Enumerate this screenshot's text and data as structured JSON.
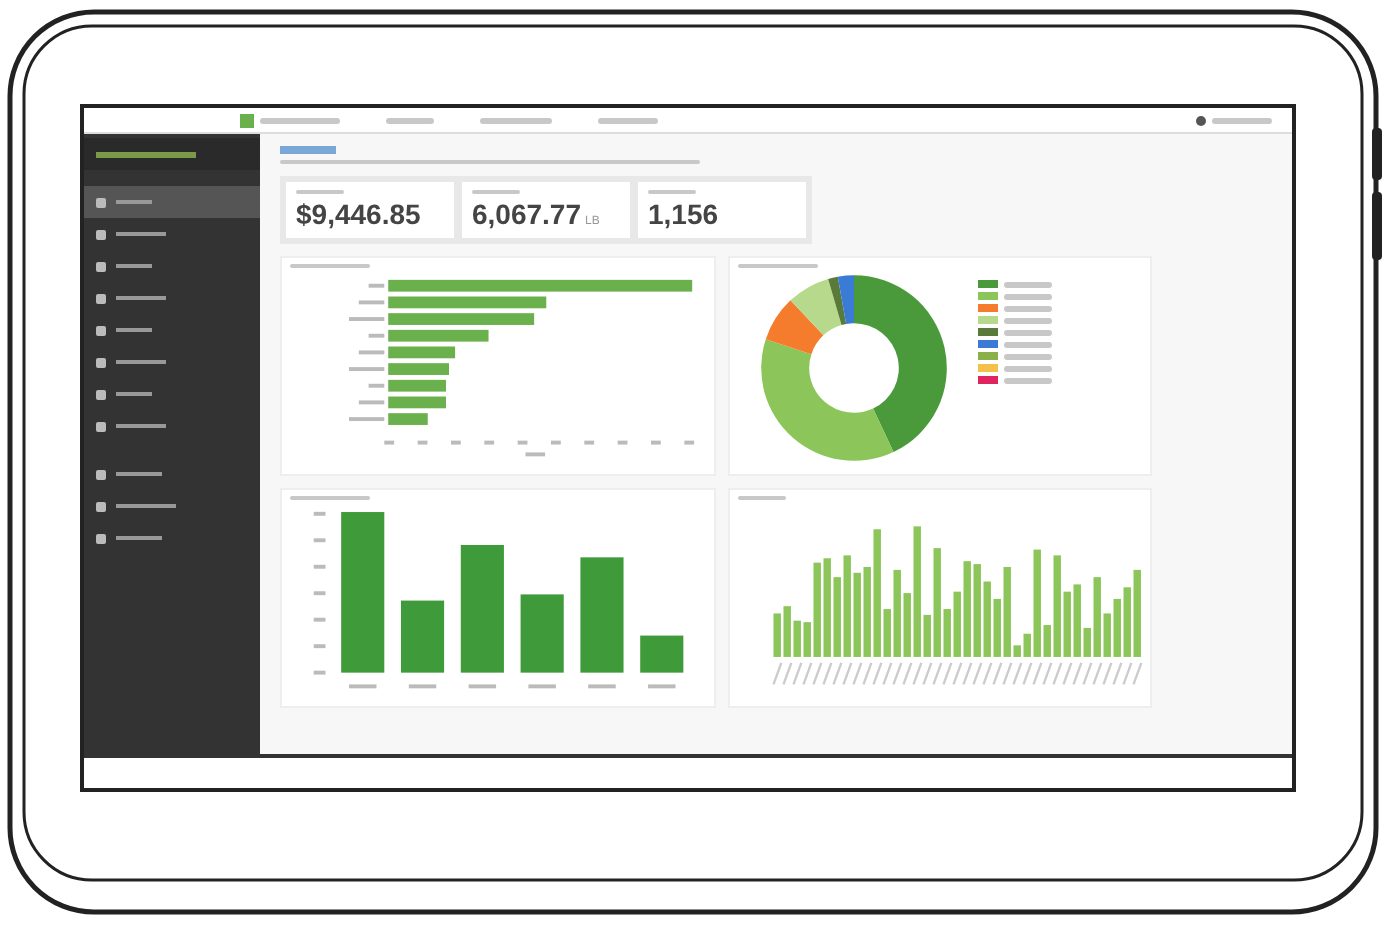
{
  "sidebar": {
    "groups": [
      [
        {
          "selected": true
        },
        {
          "selected": false
        },
        {
          "selected": false
        },
        {
          "selected": false
        },
        {
          "selected": false
        },
        {
          "selected": false
        },
        {
          "selected": false
        },
        {
          "selected": false
        }
      ],
      [
        {
          "selected": false
        },
        {
          "selected": false
        },
        {
          "selected": false
        }
      ]
    ]
  },
  "stats": [
    {
      "value": "$9,446.85"
    },
    {
      "value": "6,067.77",
      "unit": "LB"
    },
    {
      "value": "1,156"
    }
  ],
  "donut_legend": [
    {
      "color": "#4a9a3c"
    },
    {
      "color": "#8cc65a"
    },
    {
      "color": "#f47c2c"
    },
    {
      "color": "#b7d98c"
    },
    {
      "color": "#5a7a3a"
    },
    {
      "color": "#3a7bd5"
    },
    {
      "color": "#8ab04a"
    },
    {
      "color": "#f5c04a"
    },
    {
      "color": "#e0245e"
    }
  ]
}
